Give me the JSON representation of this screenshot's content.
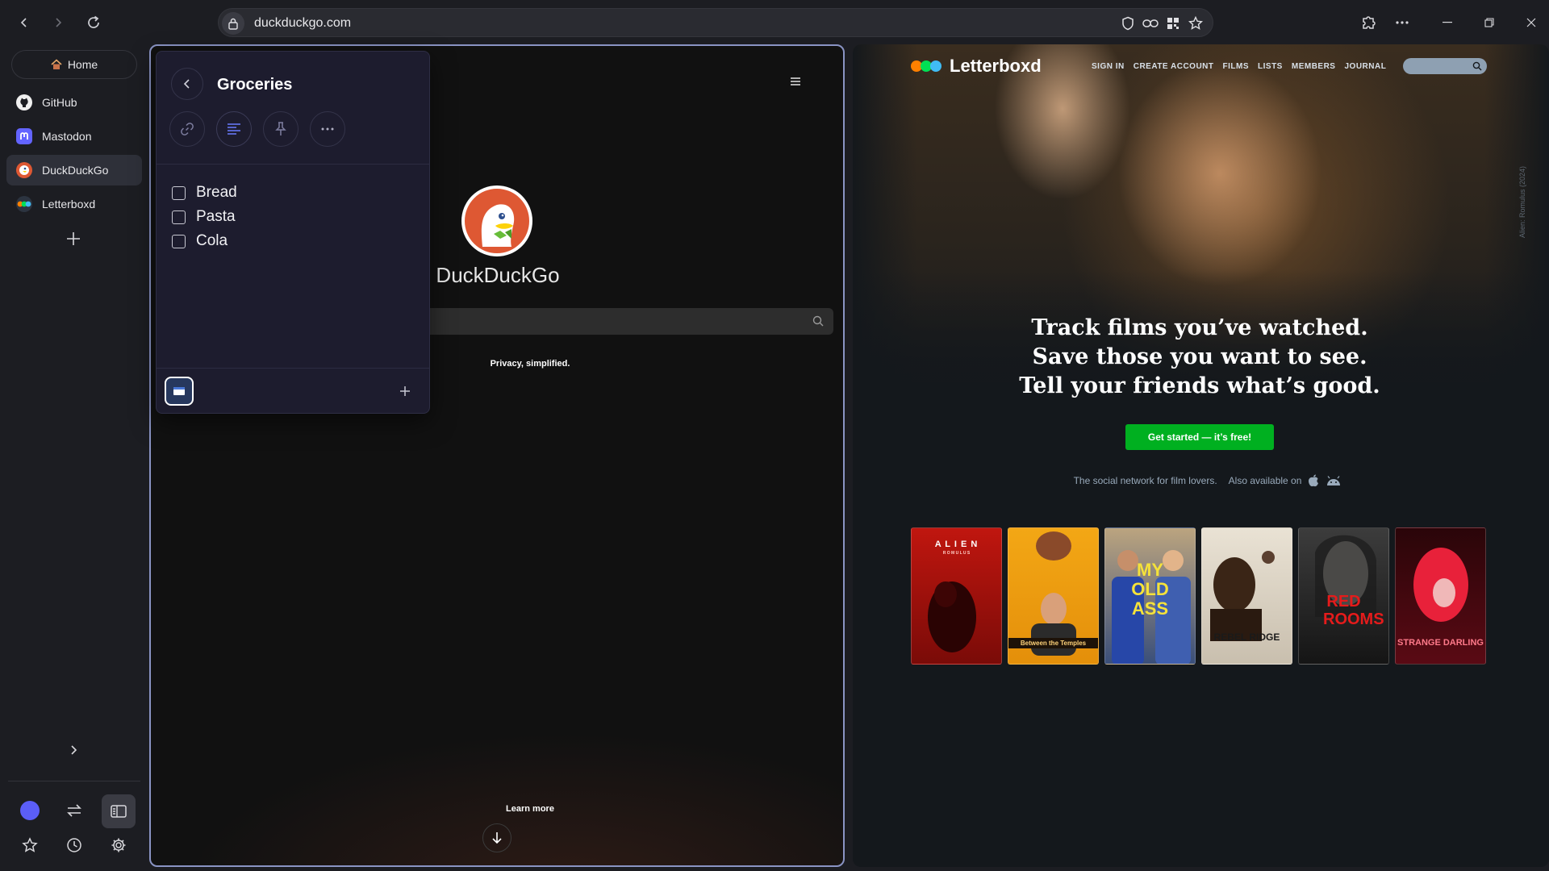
{
  "browser": {
    "url": "duckduckgo.com"
  },
  "sidebar": {
    "home_label": "Home",
    "items": [
      {
        "label": "GitHub",
        "icon": "github-icon"
      },
      {
        "label": "Mastodon",
        "icon": "mastodon-icon"
      },
      {
        "label": "DuckDuckGo",
        "icon": "duckduckgo-icon",
        "active": true
      },
      {
        "label": "Letterboxd",
        "icon": "letterboxd-icon"
      }
    ]
  },
  "notes": {
    "title": "Groceries",
    "items": [
      "Bread",
      "Pasta",
      "Cola"
    ]
  },
  "ddg": {
    "name": "DuckDuckGo",
    "tagline": "Privacy, simplified.",
    "learn_more": "Learn more"
  },
  "letterboxd": {
    "brand": "Letterboxd",
    "nav": [
      "SIGN IN",
      "CREATE ACCOUNT",
      "FILMS",
      "LISTS",
      "MEMBERS",
      "JOURNAL"
    ],
    "credit": "Alien: Romulus (2024)",
    "tagline": [
      "Track films you’ve watched.",
      "Save those you want to see.",
      "Tell your friends what’s good."
    ],
    "cta": "Get started — it’s free!",
    "social": "The social network for film lovers.",
    "available": "Also available on",
    "posters": [
      {
        "title": "A L I E N",
        "subtitle": "R O M U L U S",
        "color": "#b3130f"
      },
      {
        "title": "Between the Temples",
        "color": "#f0a512"
      },
      {
        "title": "MY OLD ASS",
        "color": "#2b3a6e"
      },
      {
        "title": "REBEL RIDGE",
        "color": "#d8d2c6"
      },
      {
        "title": "RED ROOMS",
        "color": "#2a2a2a"
      },
      {
        "title": "STRANGE DARLING",
        "color": "#3b0710"
      }
    ]
  },
  "colors": {
    "accent": "#5b5ef7",
    "pane_border": "#8a94c4",
    "lb_green": "#00b020",
    "ddg_orange": "#de5833"
  }
}
